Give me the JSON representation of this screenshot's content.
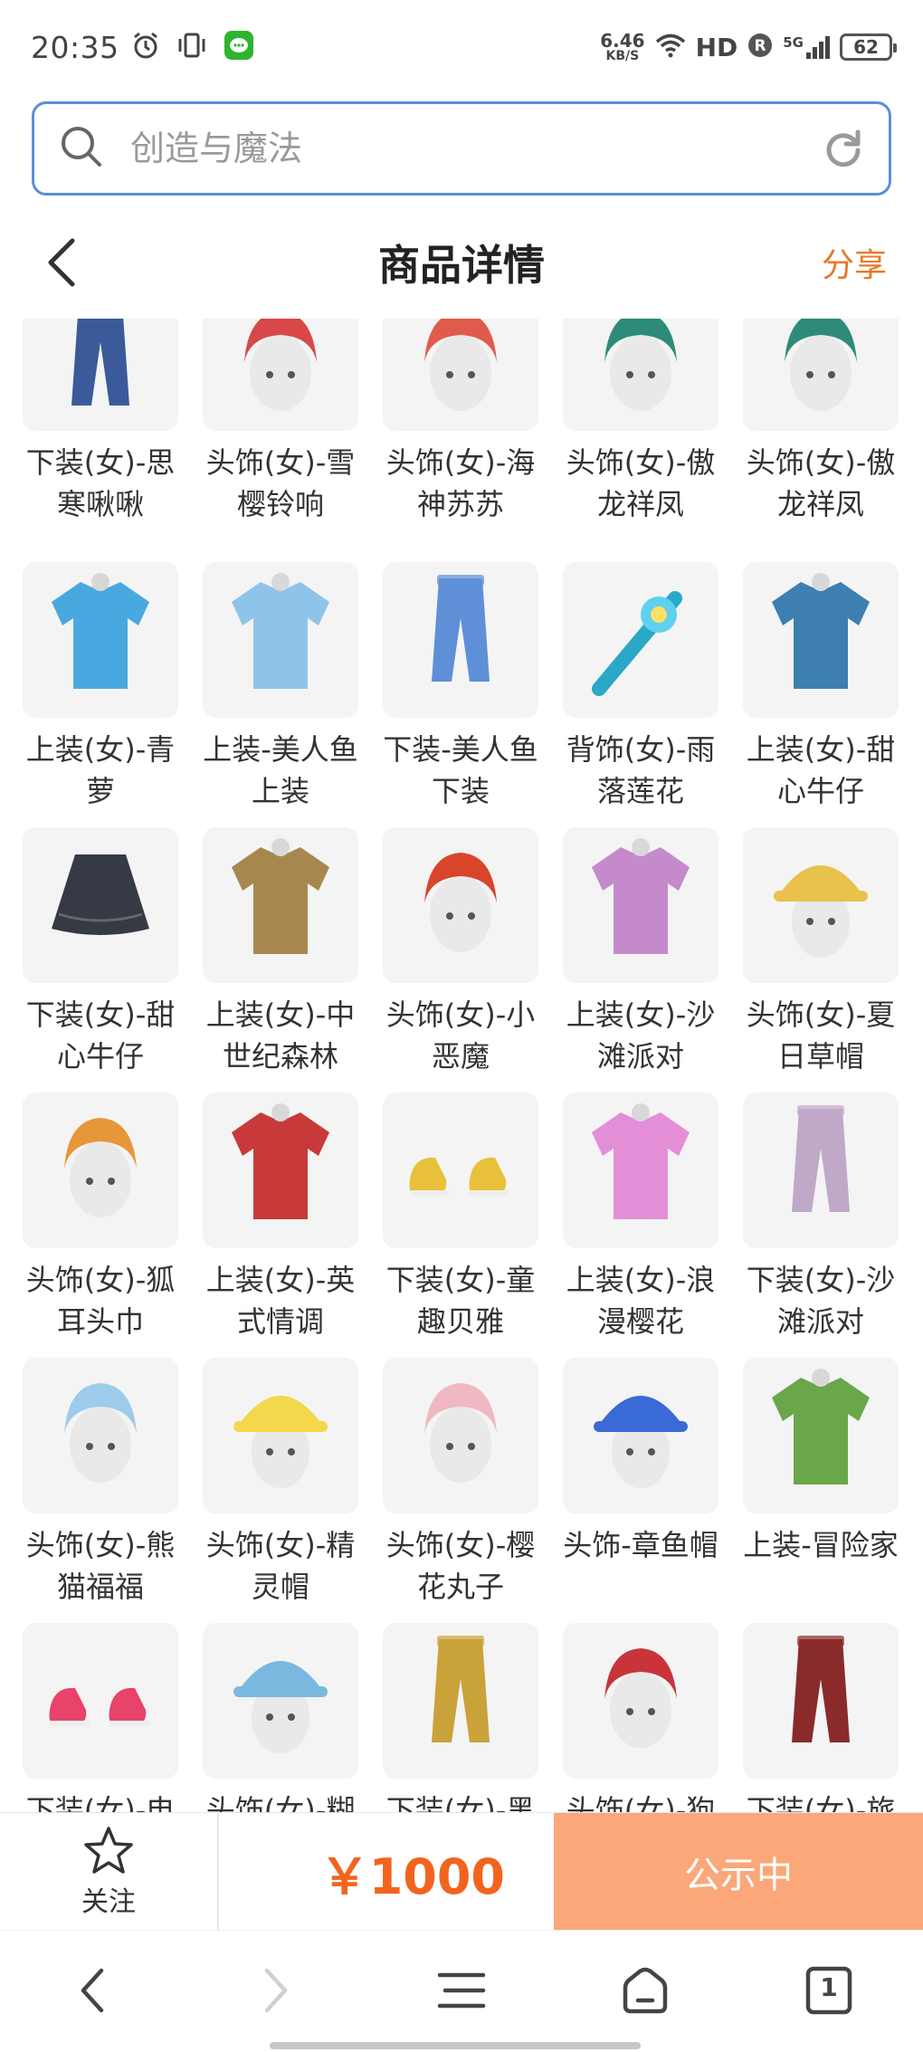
{
  "status_bar": {
    "time": "20:35",
    "net_speed_value": "6.46",
    "net_speed_unit": "KB/S",
    "network_label": "HD",
    "signal_label": "5G",
    "battery": "62"
  },
  "search": {
    "placeholder": "创造与魔法"
  },
  "header": {
    "title": "商品详情",
    "share_label": "分享"
  },
  "items": [
    {
      "name": "下装(女)-思寒啾啾",
      "icon": "pants-icon",
      "color": "#3b5a9a"
    },
    {
      "name": "头饰(女)-雪樱铃响",
      "icon": "headwear-icon",
      "color": "#d94848"
    },
    {
      "name": "头饰(女)-海神苏苏",
      "icon": "headwear-icon",
      "color": "#e05b4b"
    },
    {
      "name": "头饰(女)-傲龙祥凤",
      "icon": "headwear-icon",
      "color": "#2e8b7a"
    },
    {
      "name": "头饰(女)-傲龙祥凤",
      "icon": "headwear-icon",
      "color": "#2e8b7a"
    },
    {
      "name": "上装(女)-青萝",
      "icon": "top-icon",
      "color": "#4aa8e0"
    },
    {
      "name": "上装-美人鱼上装",
      "icon": "top-icon",
      "color": "#8fc4ea"
    },
    {
      "name": "下装-美人鱼下装",
      "icon": "pants-icon",
      "color": "#5f8fd6"
    },
    {
      "name": "背饰(女)-雨落莲花",
      "icon": "back-accessory-icon",
      "color": "#2aa8c8"
    },
    {
      "name": "上装(女)-甜心牛仔",
      "icon": "top-icon",
      "color": "#3d7fb0"
    },
    {
      "name": "下装(女)-甜心牛仔",
      "icon": "skirt-icon",
      "color": "#353a45"
    },
    {
      "name": "上装(女)-中世纪森林",
      "icon": "top-icon",
      "color": "#a8874f"
    },
    {
      "name": "头饰(女)-小恶魔",
      "icon": "headwear-icon",
      "color": "#d9452b"
    },
    {
      "name": "上装(女)-沙滩派对",
      "icon": "top-icon",
      "color": "#c58acb"
    },
    {
      "name": "头饰(女)-夏日草帽",
      "icon": "hat-icon",
      "color": "#e8c24a"
    },
    {
      "name": "头饰(女)-狐耳头巾",
      "icon": "headwear-icon",
      "color": "#e8963a"
    },
    {
      "name": "上装(女)-英式情调",
      "icon": "top-icon",
      "color": "#c83a3a"
    },
    {
      "name": "下装(女)-童趣贝雅",
      "icon": "shoes-icon",
      "color": "#e8c03a"
    },
    {
      "name": "上装(女)-浪漫樱花",
      "icon": "top-icon",
      "color": "#e58ed8"
    },
    {
      "name": "下装(女)-沙滩派对",
      "icon": "pants-icon",
      "color": "#c0a8c8"
    },
    {
      "name": "头饰(女)-熊猫福福",
      "icon": "headwear-icon",
      "color": "#9ecbea"
    },
    {
      "name": "头饰(女)-精灵帽",
      "icon": "hat-icon",
      "color": "#f2d84a"
    },
    {
      "name": "头饰(女)-樱花丸子",
      "icon": "headwear-icon",
      "color": "#f0b8c0"
    },
    {
      "name": "头饰-章鱼帽",
      "icon": "hat-icon",
      "color": "#3a6ad6"
    },
    {
      "name": "上装-冒险家",
      "icon": "top-icon",
      "color": "#6aa64a"
    },
    {
      "name": "下装(女)-电音少女",
      "icon": "shoes-icon",
      "color": "#e8436a"
    },
    {
      "name": "头饰(女)-糊涂睡帽",
      "icon": "hat-icon",
      "color": "#7ab8e0"
    },
    {
      "name": "下装(女)-黑夜传说・精",
      "icon": "pants-icon",
      "color": "#c9a23a"
    },
    {
      "name": "头饰(女)-狗狗耳",
      "icon": "headwear-icon",
      "color": "#c8343a"
    },
    {
      "name": "下装(女)-旅途之星",
      "icon": "pants-icon",
      "color": "#8a2a2a"
    }
  ],
  "action_bar": {
    "follow_label": "关注",
    "price": "￥1000",
    "status_label": "公示中"
  },
  "nav": {
    "tab_count": "1"
  },
  "colors": {
    "accent": "#e8782a",
    "price": "#f2641e",
    "status_button": "#fba779",
    "search_border": "#5b8fd6"
  }
}
